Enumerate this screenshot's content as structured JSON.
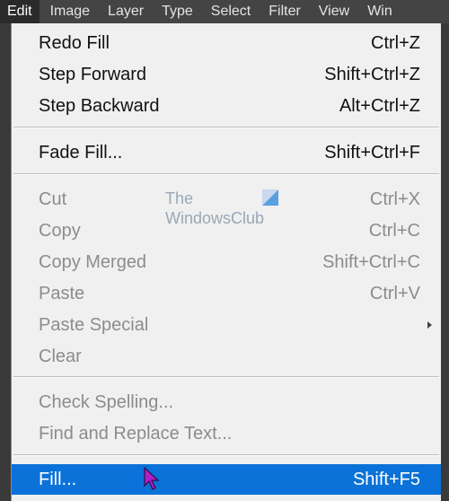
{
  "menubar": {
    "items": [
      {
        "label": "Edit"
      },
      {
        "label": "Image"
      },
      {
        "label": "Layer"
      },
      {
        "label": "Type"
      },
      {
        "label": "Select"
      },
      {
        "label": "Filter"
      },
      {
        "label": "View"
      },
      {
        "label": "Win"
      }
    ],
    "active": "Edit"
  },
  "edit_menu": {
    "groups": [
      [
        {
          "label": "Redo Fill",
          "shortcut": "Ctrl+Z",
          "enabled": true
        },
        {
          "label": "Step Forward",
          "shortcut": "Shift+Ctrl+Z",
          "enabled": true
        },
        {
          "label": "Step Backward",
          "shortcut": "Alt+Ctrl+Z",
          "enabled": true
        }
      ],
      [
        {
          "label": "Fade Fill...",
          "shortcut": "Shift+Ctrl+F",
          "enabled": true
        }
      ],
      [
        {
          "label": "Cut",
          "shortcut": "Ctrl+X",
          "enabled": false
        },
        {
          "label": "Copy",
          "shortcut": "Ctrl+C",
          "enabled": false
        },
        {
          "label": "Copy Merged",
          "shortcut": "Shift+Ctrl+C",
          "enabled": false
        },
        {
          "label": "Paste",
          "shortcut": "Ctrl+V",
          "enabled": false
        },
        {
          "label": "Paste Special",
          "shortcut": "",
          "enabled": false,
          "submenu": true
        },
        {
          "label": "Clear",
          "shortcut": "",
          "enabled": false
        }
      ],
      [
        {
          "label": "Check Spelling...",
          "shortcut": "",
          "enabled": false
        },
        {
          "label": "Find and Replace Text...",
          "shortcut": "",
          "enabled": false
        }
      ],
      [
        {
          "label": "Fill...",
          "shortcut": "Shift+F5",
          "enabled": true,
          "selected": true
        }
      ]
    ]
  },
  "watermark": {
    "line1": "The",
    "line2": "WindowsClub"
  },
  "colors": {
    "menubar_bg": "#444444",
    "menu_bg": "#f0f0f0",
    "selection": "#0a72d8",
    "disabled_text": "#8c8c8c",
    "cursor": "#b020c8"
  },
  "icons": {
    "cursor": "arrow-pointer-icon",
    "submenu": "chevron-right-icon",
    "watermark_logo": "windows-logo-icon"
  }
}
